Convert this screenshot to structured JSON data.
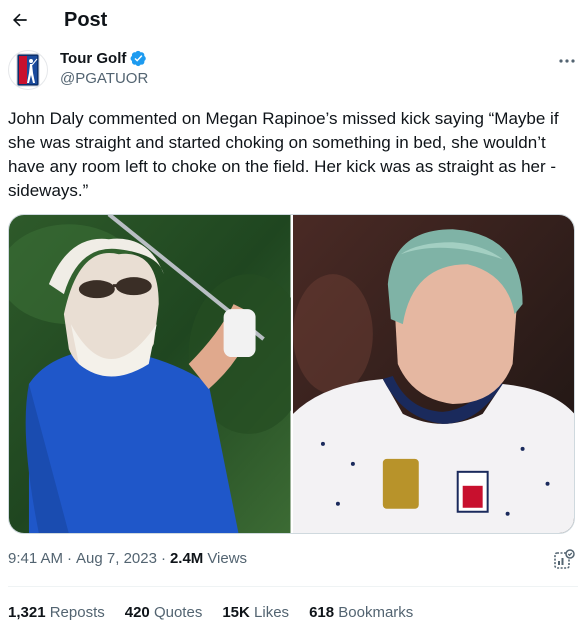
{
  "header": {
    "title": "Post",
    "back_icon": "arrow-left-icon"
  },
  "author": {
    "name": "Tour Golf",
    "handle": "@PGATUOR",
    "verified_icon": "verified-badge-icon",
    "verified_color": "#1d9bf0",
    "more_icon": "more-horizontal-icon"
  },
  "tweet": {
    "text": "John Daly commented on Megan Rapinoe’s missed kick saying “Maybe if she was straight and started choking on something in bed, she wouldn’t have any room left to choke on the field. Her kick was as straight as her - sideways.”"
  },
  "meta": {
    "time": "9:41 AM",
    "date": "Aug 7, 2023",
    "views_count": "2.4M",
    "views_label": "Views",
    "separator": "·",
    "analytics_icon": "analytics-icon"
  },
  "stats": [
    {
      "count": "1,321",
      "label": "Reposts"
    },
    {
      "count": "420",
      "label": "Quotes"
    },
    {
      "count": "15K",
      "label": "Likes"
    },
    {
      "count": "618",
      "label": "Bookmarks"
    }
  ],
  "colors": {
    "text": "#0f1419",
    "muted": "#536471",
    "border": "#eff3f4",
    "accent": "#1d9bf0"
  }
}
